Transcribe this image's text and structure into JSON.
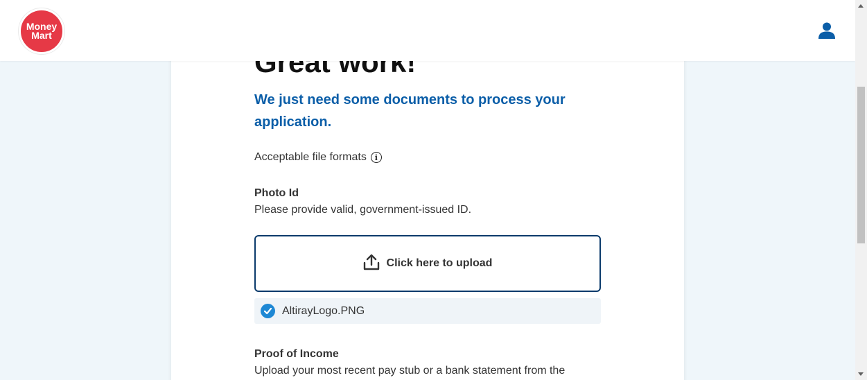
{
  "header": {
    "logo_line1": "Money",
    "logo_line2": "Mart",
    "brand_color": "#e63946"
  },
  "page": {
    "heading": "Great work!",
    "subheading": "We just need some documents to process your application.",
    "formats_label": "Acceptable file formats",
    "info_icon_glyph": "i"
  },
  "photo_id": {
    "title": "Photo Id",
    "description": "Please provide valid, government-issued ID.",
    "upload_label": "Click here to upload",
    "uploaded_file": "AltirayLogo.PNG"
  },
  "proof_of_income": {
    "title": "Proof of Income",
    "description": "Upload your most recent pay stub or a bank statement from the"
  },
  "colors": {
    "accent": "#0b5ea8",
    "upload_border": "#0a3a6b",
    "check": "#1e88d4"
  }
}
